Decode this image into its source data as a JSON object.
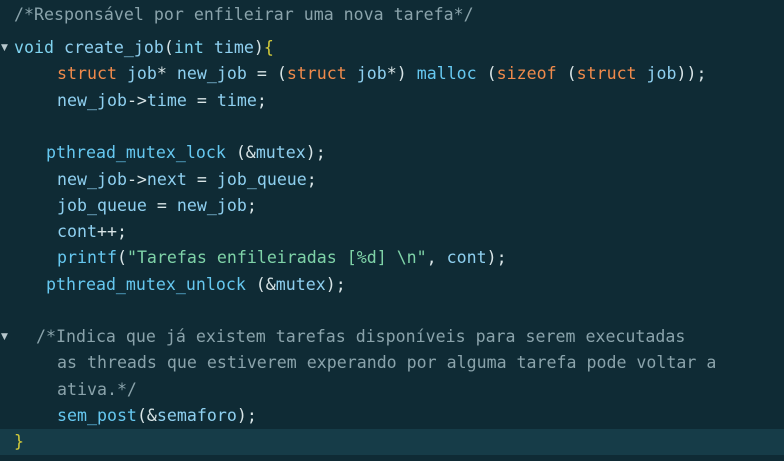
{
  "colors": {
    "background": "#0f2b35",
    "current_line": "#163c48",
    "comment": "#8aa3ab",
    "type": "#f08a4b",
    "identifier": "#8fd0f0",
    "string": "#7fd3a8",
    "brace": "#d4cc3a"
  },
  "icons": {
    "fold_arrow": "▼"
  },
  "lines": [
    {
      "fold": false,
      "segments": [
        {
          "t": "/*Responsável por enfileirar uma nova tarefa*/",
          "c": "comment"
        }
      ]
    },
    {
      "fold": true,
      "segments": [
        {
          "t": "void",
          "c": "keyword"
        },
        {
          "t": " ",
          "c": "punc"
        },
        {
          "t": "create_job",
          "c": "fn"
        },
        {
          "t": "(",
          "c": "punc"
        },
        {
          "t": "int",
          "c": "keyword"
        },
        {
          "t": " time",
          "c": "var"
        },
        {
          "t": ")",
          "c": "punc"
        },
        {
          "t": "{",
          "c": "brace"
        }
      ]
    },
    {
      "fold": false,
      "segments": [
        {
          "t": "struct",
          "c": "type"
        },
        {
          "t": " job",
          "c": "var"
        },
        {
          "t": "*",
          "c": "punc"
        },
        {
          "t": " new_job ",
          "c": "var"
        },
        {
          "t": "=",
          "c": "punc"
        },
        {
          "t": " (",
          "c": "punc"
        },
        {
          "t": "struct",
          "c": "type"
        },
        {
          "t": " job",
          "c": "var"
        },
        {
          "t": "*)",
          "c": "punc"
        },
        {
          "t": " malloc ",
          "c": "call"
        },
        {
          "t": "(",
          "c": "punc"
        },
        {
          "t": "sizeof",
          "c": "type"
        },
        {
          "t": " (",
          "c": "punc"
        },
        {
          "t": "struct",
          "c": "type"
        },
        {
          "t": " job",
          "c": "var"
        },
        {
          "t": "));",
          "c": "punc"
        }
      ]
    },
    {
      "fold": false,
      "segments": [
        {
          "t": "new_job",
          "c": "var"
        },
        {
          "t": "->",
          "c": "punc"
        },
        {
          "t": "time",
          "c": "var"
        },
        {
          "t": " = ",
          "c": "punc"
        },
        {
          "t": "time",
          "c": "var"
        },
        {
          "t": ";",
          "c": "punc"
        }
      ]
    },
    {
      "fold": false,
      "segments": []
    },
    {
      "fold": false,
      "segments": [
        {
          "t": "pthread_mutex_lock",
          "c": "call"
        },
        {
          "t": " (&",
          "c": "punc"
        },
        {
          "t": "mutex",
          "c": "var"
        },
        {
          "t": ");",
          "c": "punc"
        }
      ]
    },
    {
      "fold": false,
      "segments": [
        {
          "t": "new_job",
          "c": "var"
        },
        {
          "t": "->",
          "c": "punc"
        },
        {
          "t": "next",
          "c": "var"
        },
        {
          "t": " = ",
          "c": "punc"
        },
        {
          "t": "job_queue",
          "c": "var"
        },
        {
          "t": ";",
          "c": "punc"
        }
      ]
    },
    {
      "fold": false,
      "segments": [
        {
          "t": "job_queue",
          "c": "var"
        },
        {
          "t": " = ",
          "c": "punc"
        },
        {
          "t": "new_job",
          "c": "var"
        },
        {
          "t": ";",
          "c": "punc"
        }
      ]
    },
    {
      "fold": false,
      "segments": [
        {
          "t": "cont",
          "c": "var"
        },
        {
          "t": "++;",
          "c": "punc"
        }
      ]
    },
    {
      "fold": false,
      "segments": [
        {
          "t": "printf",
          "c": "call"
        },
        {
          "t": "(",
          "c": "punc"
        },
        {
          "t": "\"Tarefas enfileiradas [%d] \\n\"",
          "c": "str"
        },
        {
          "t": ", ",
          "c": "punc"
        },
        {
          "t": "cont",
          "c": "var"
        },
        {
          "t": ");",
          "c": "punc"
        }
      ]
    },
    {
      "fold": false,
      "segments": [
        {
          "t": "pthread_mutex_unlock",
          "c": "call"
        },
        {
          "t": " (&",
          "c": "punc"
        },
        {
          "t": "mutex",
          "c": "var"
        },
        {
          "t": ");",
          "c": "punc"
        }
      ]
    },
    {
      "fold": false,
      "segments": []
    },
    {
      "fold": true,
      "segments": [
        {
          "t": "/*Indica que já existem tarefas disponíveis para serem executadas",
          "c": "comment"
        }
      ]
    },
    {
      "fold": false,
      "segments": [
        {
          "t": "as threads que estiverem experando por alguma tarefa pode voltar a",
          "c": "comment"
        }
      ]
    },
    {
      "fold": false,
      "segments": [
        {
          "t": "ativa.*/",
          "c": "comment"
        }
      ]
    },
    {
      "fold": false,
      "segments": [
        {
          "t": "sem_post",
          "c": "call"
        },
        {
          "t": "(&",
          "c": "punc"
        },
        {
          "t": "semaforo",
          "c": "var"
        },
        {
          "t": ");",
          "c": "punc"
        }
      ]
    },
    {
      "fold": false,
      "current": true,
      "segments": [
        {
          "t": "}",
          "c": "brace"
        }
      ]
    }
  ]
}
